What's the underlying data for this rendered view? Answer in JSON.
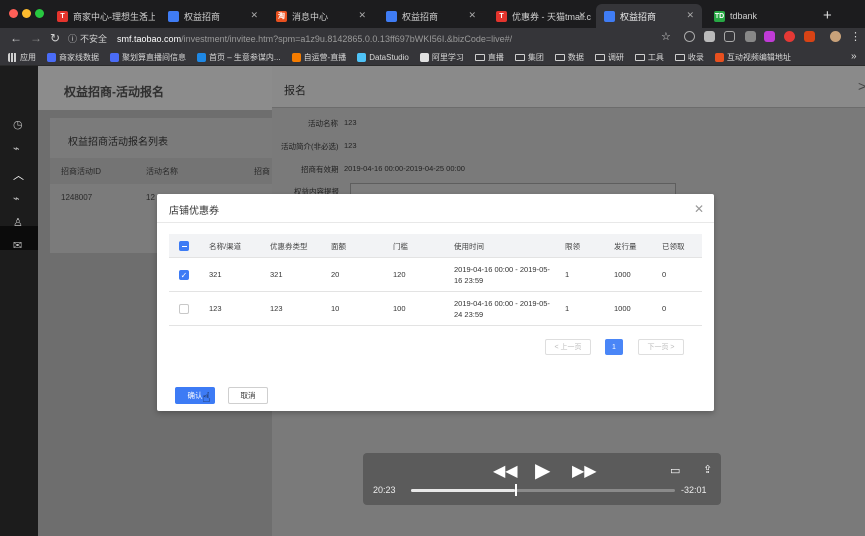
{
  "browser": {
    "tabs": [
      {
        "label": "商家中心-理想生活上",
        "fav_color": "#e4342d",
        "fav_glyph": "T",
        "active": false
      },
      {
        "label": "权益招商",
        "fav_color": "#3f7cf4",
        "fav_glyph": "",
        "active": false
      },
      {
        "label": "消息中心",
        "fav_color": "#e8501f",
        "fav_glyph": "淘",
        "active": false
      },
      {
        "label": "权益招商",
        "fav_color": "#3f7cf4",
        "fav_glyph": "",
        "active": false
      },
      {
        "label": "优惠券 - 天猫tmall.c",
        "fav_color": "#e4342d",
        "fav_glyph": "T",
        "active": false
      },
      {
        "label": "权益招商",
        "fav_color": "#3f7cf4",
        "fav_glyph": "",
        "active": true
      },
      {
        "label": "tdbank",
        "fav_color": "#27a844",
        "fav_glyph": "TD",
        "active": false
      }
    ],
    "url": {
      "insecure_label": "不安全",
      "host": "smf.taobao.com",
      "path": "/investment/invitee.htm?spm=a1z9u.8142865.0.0.13ff697bWKI56I.&bizCode=live#/"
    },
    "bookmarks": [
      {
        "label": "应用",
        "kind": "apps"
      },
      {
        "label": "商家线数据",
        "kind": "icon",
        "color": "#4a6cf7"
      },
      {
        "label": "聚划算直播间信息",
        "kind": "icon",
        "color": "#4a6cf7"
      },
      {
        "label": "首页 – 生意参谋内...",
        "kind": "icon",
        "color": "#1e88e5"
      },
      {
        "label": "自运营-直播",
        "kind": "icon",
        "color": "#f57c00"
      },
      {
        "label": "DataStudio",
        "kind": "icon",
        "color": "#4fc3f7"
      },
      {
        "label": "阿里学习",
        "kind": "icon",
        "color": "#e0e0e0"
      },
      {
        "label": "直播",
        "kind": "folder"
      },
      {
        "label": "集团",
        "kind": "folder"
      },
      {
        "label": "数据",
        "kind": "folder"
      },
      {
        "label": "调研",
        "kind": "folder"
      },
      {
        "label": "工具",
        "kind": "folder"
      },
      {
        "label": "收录",
        "kind": "folder"
      },
      {
        "label": "互动视频编辑地址",
        "kind": "icon",
        "color": "#e8501f"
      }
    ]
  },
  "page": {
    "title": "权益招商-活动报名",
    "list_title": "权益招商活动报名列表",
    "list_headers": [
      "招商活动ID",
      "活动名称",
      "招商"
    ],
    "list_rows": [
      [
        "1248007",
        "12",
        ""
      ]
    ]
  },
  "drawer": {
    "title": "报名",
    "fields": [
      {
        "label": "活动名称",
        "value": "123"
      },
      {
        "label": "活动简介(非必选)",
        "value": "123"
      },
      {
        "label": "招商有效期",
        "value": "2019-04-16 00:00-2019-04-25 00:00"
      },
      {
        "label": "权益内容提报",
        "value": ""
      }
    ]
  },
  "modal": {
    "title": "店铺优惠券",
    "headers": [
      "名称/渠道",
      "优惠券类型",
      "面额",
      "门槛",
      "使用时间",
      "限领",
      "发行量",
      "已领取"
    ],
    "rows": [
      {
        "checked": true,
        "name": "321",
        "type": "321",
        "face": "20",
        "threshold": "120",
        "time_line1": "2019-04-16 00:00 - 2019-05-",
        "time_line2": "16 23:59",
        "limit": "1",
        "issued": "1000",
        "claimed": "0"
      },
      {
        "checked": false,
        "name": "123",
        "type": "123",
        "face": "10",
        "threshold": "100",
        "time_line1": "2019-04-16 00:00 - 2019-05-",
        "time_line2": "24 23:59",
        "limit": "1",
        "issued": "1000",
        "claimed": "0"
      }
    ],
    "pagination": {
      "prev": "上一页",
      "current": "1",
      "next": "下一页"
    },
    "confirm_label": "确认",
    "cancel_label": "取消"
  },
  "video": {
    "elapsed": "20:23",
    "remaining": "-32:01",
    "progress": 0.393
  }
}
